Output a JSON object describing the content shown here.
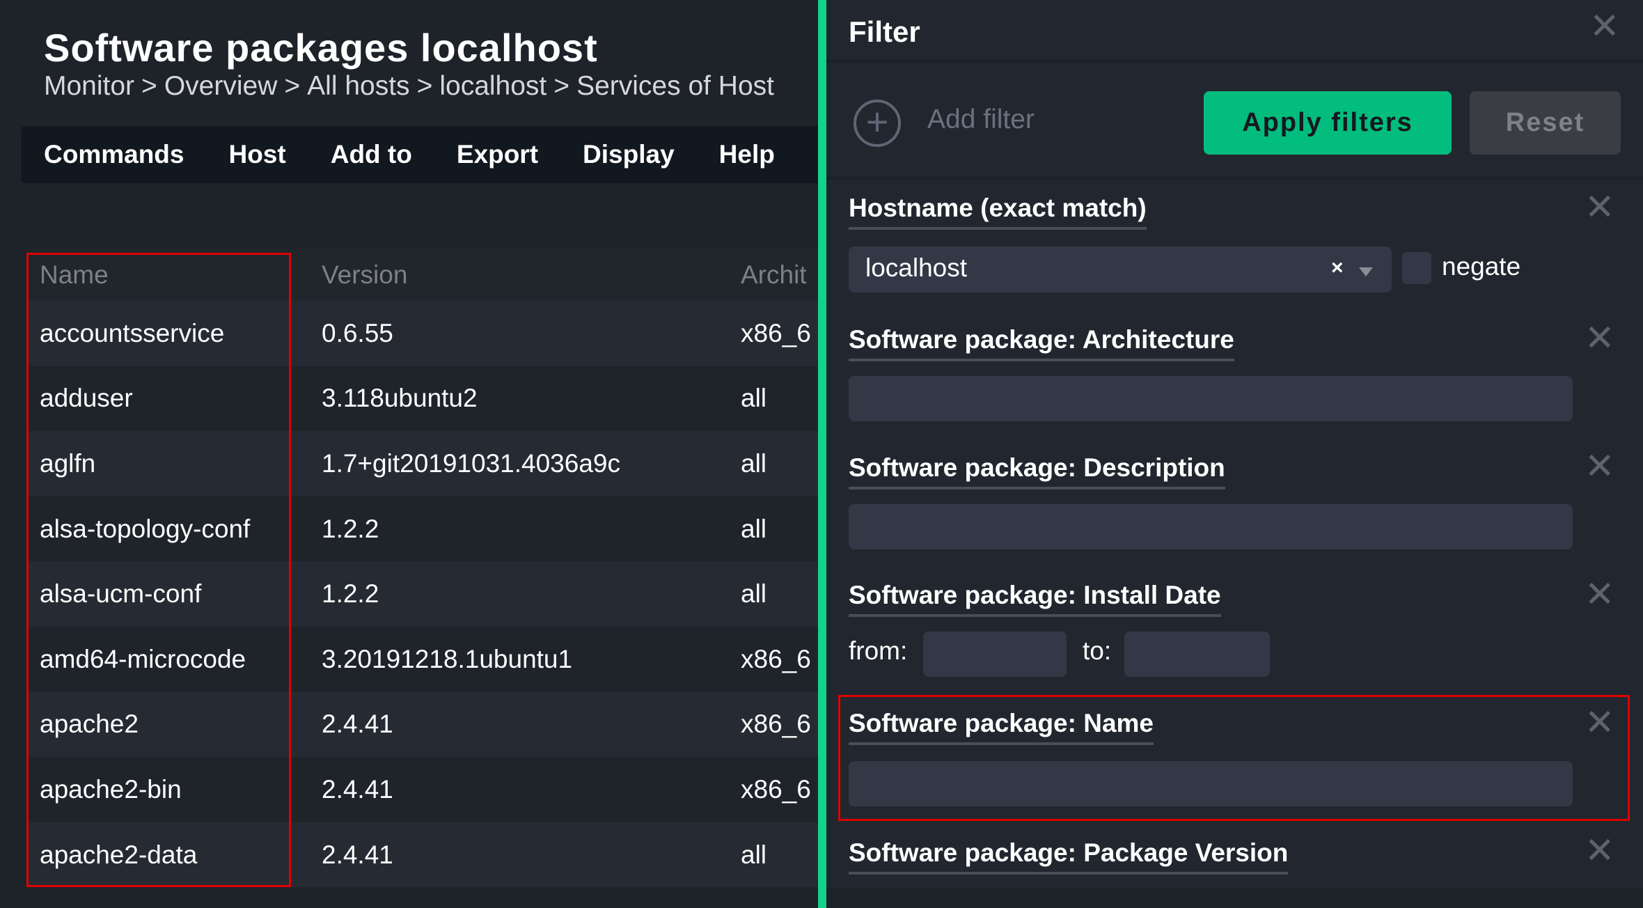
{
  "page": {
    "title": "Software packages localhost",
    "breadcrumb": [
      "Monitor",
      "Overview",
      "All hosts",
      "localhost",
      "Services of Host"
    ],
    "breadcrumb_separator": ">"
  },
  "menu": [
    "Commands",
    "Host",
    "Add to",
    "Export",
    "Display",
    "Help"
  ],
  "table": {
    "columns": [
      "Name",
      "Version",
      "Archit"
    ],
    "rows": [
      [
        "accountsservice",
        "0.6.55",
        "x86_6"
      ],
      [
        "adduser",
        "3.118ubuntu2",
        "all"
      ],
      [
        "aglfn",
        "1.7+git20191031.4036a9c",
        "all"
      ],
      [
        "alsa-topology-conf",
        "1.2.2",
        "all"
      ],
      [
        "alsa-ucm-conf",
        "1.2.2",
        "all"
      ],
      [
        "amd64-microcode",
        "3.20191218.1ubuntu1",
        "x86_6"
      ],
      [
        "apache2",
        "2.4.41",
        "x86_6"
      ],
      [
        "apache2-bin",
        "2.4.41",
        "x86_6"
      ],
      [
        "apache2-data",
        "2.4.41",
        "all"
      ]
    ]
  },
  "filter": {
    "title": "Filter",
    "add_filter": "Add filter",
    "apply": "Apply filters",
    "reset": "Reset",
    "hostname": {
      "title": "Hostname (exact match)",
      "value": "localhost",
      "clear": "×",
      "negate": "negate",
      "negate_checked": false
    },
    "architecture": {
      "title": "Software package: Architecture",
      "value": ""
    },
    "description": {
      "title": "Software package: Description",
      "value": ""
    },
    "install_date": {
      "title": "Software package: Install Date",
      "from": "from:",
      "to": "to:"
    },
    "name": {
      "title": "Software package: Name",
      "value": ""
    },
    "package_version": {
      "title": "Software package: Package Version"
    }
  },
  "colors": {
    "accent": "#13d389",
    "apply_button": "#02bd7d",
    "highlight": "#e00000"
  }
}
